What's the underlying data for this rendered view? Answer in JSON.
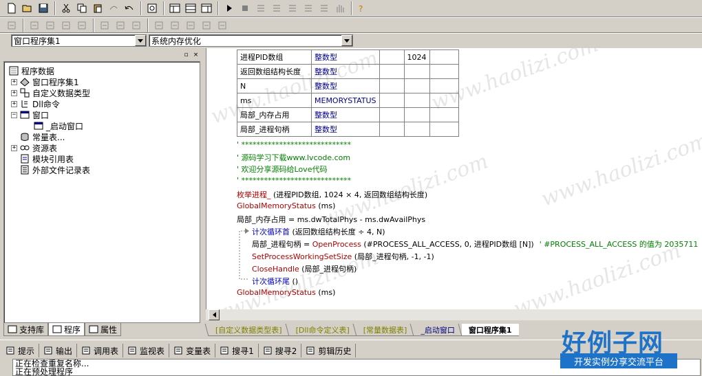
{
  "toolbar_row1": [
    "new-file-icon",
    "open-folder-icon",
    "save-icon",
    "cut-icon",
    "copy-icon",
    "paste-icon",
    "redo-icon",
    "undo-icon",
    "find-icon",
    "layout1-icon",
    "layout2-icon",
    "layout3-icon",
    "run-icon",
    "stop-icon",
    "step-icon",
    "step-into-icon",
    "step-over-icon",
    "step-out-icon",
    "watch-icon",
    "breakpoint-hand-icon",
    "help-icon"
  ],
  "toolbar_row2": [
    "align-left-icon",
    "align-center-icon",
    "align-right-icon",
    "align-top-icon",
    "align-middle-icon",
    "align-bottom-icon",
    "same-width-icon",
    "same-height-icon",
    "same-size-icon",
    "center-h-icon",
    "center-v-icon",
    "space-h-icon",
    "space-v-icon"
  ],
  "combo_left": "窗口程序集1",
  "combo_right": "系统内存优化",
  "tree": {
    "root": "程序数据",
    "items": [
      {
        "label": "窗口程序集1",
        "icon": "module-icon"
      },
      {
        "label": "自定义数据类型",
        "icon": "datatype-icon"
      },
      {
        "label": "Dll命令",
        "icon": "dll-icon"
      },
      {
        "label": "窗口",
        "icon": "window-icon"
      },
      {
        "label": "_启动窗口",
        "icon": "window-icon"
      },
      {
        "label": "常量表...",
        "icon": "constant-icon"
      },
      {
        "label": "资源表",
        "icon": "resource-icon"
      },
      {
        "label": "模块引用表",
        "icon": "module-ref-icon"
      },
      {
        "label": "外部文件记录表",
        "icon": "file-list-icon"
      }
    ]
  },
  "left_tabs": [
    "支持库",
    "程序",
    "属性"
  ],
  "var_table": [
    [
      "进程PID数组",
      "整数型",
      "",
      "1024",
      ""
    ],
    [
      "返回数组结构长度",
      "整数型",
      "",
      "",
      ""
    ],
    [
      "N",
      "整数型",
      "",
      "",
      ""
    ],
    [
      "ms",
      "MEMORYSTATUS",
      "",
      "",
      ""
    ],
    [
      "局部_内存占用",
      "整数型",
      "",
      "",
      ""
    ],
    [
      "局部_进程句柄",
      "整数型",
      "",
      "",
      ""
    ]
  ],
  "code": {
    "c1": "' *****************************",
    "c2": "' 源码学习下载www.lvcode.com",
    "c3": "' 欢迎分享源码给Love代码",
    "c4": "' *****************************",
    "l1_fn": "枚举进程_",
    "l1_args": " (进程PID数组, 1024 × 4, 返回数组结构长度)",
    "l2_fn": "GlobalMemoryStatus",
    "l2_args": " (ms)",
    "l3": "局部_内存占用 = ms.dwTotalPhys - ms.dwAvailPhys",
    "l4_kw": "计次循环首",
    "l4_args": " (返回数组结构长度 ÷ 4, N)",
    "l5_pre": "局部_进程句柄 = ",
    "l5_fn": "OpenProcess",
    "l5_args": " (#PROCESS_ALL_ACCESS, 0, 进程PID数组 [N])",
    "l5_cm": "' #PROCESS_ALL_ACCESS 的值为 2035711",
    "l6_fn": "SetProcessWorkingSetSize",
    "l6_args": " (局部_进程句柄, -1, -1)",
    "l7_fn": "CloseHandle",
    "l7_args": " (局部_进程句柄)",
    "l8_kw": "计次循环尾",
    "l8_args": " ()",
    "l9_fn": "GlobalMemoryStatus",
    "l9_args": " (ms)"
  },
  "doc_tabs": [
    "[自定义数据类型表]",
    "[Dll命令定义表]",
    "[常量数据表]",
    "_启动窗口",
    "窗口程序集1"
  ],
  "bottom_tabs": [
    {
      "label": "提示",
      "icon": "hint-icon"
    },
    {
      "label": "输出",
      "icon": "output-icon"
    },
    {
      "label": "调用表",
      "icon": "call-table-icon"
    },
    {
      "label": "监视表",
      "icon": "watch-icon"
    },
    {
      "label": "变量表",
      "icon": "variable-icon"
    },
    {
      "label": "搜寻1",
      "icon": "search1-icon"
    },
    {
      "label": "搜寻2",
      "icon": "search2-icon"
    },
    {
      "label": "剪辑历史",
      "icon": "clip-history-icon"
    }
  ],
  "output": [
    "正在检查重复名称...",
    "正在预处理程序"
  ],
  "watermark_text": "www.haolizi.com",
  "logo": {
    "title": "好例子网",
    "subtitle": "开发实例分享交流平台"
  },
  "colors": {
    "keyword": "#00008b",
    "comment": "#008000",
    "function": "#b00000",
    "control": "#0000c0",
    "logo_blue": "#1e73c8"
  }
}
